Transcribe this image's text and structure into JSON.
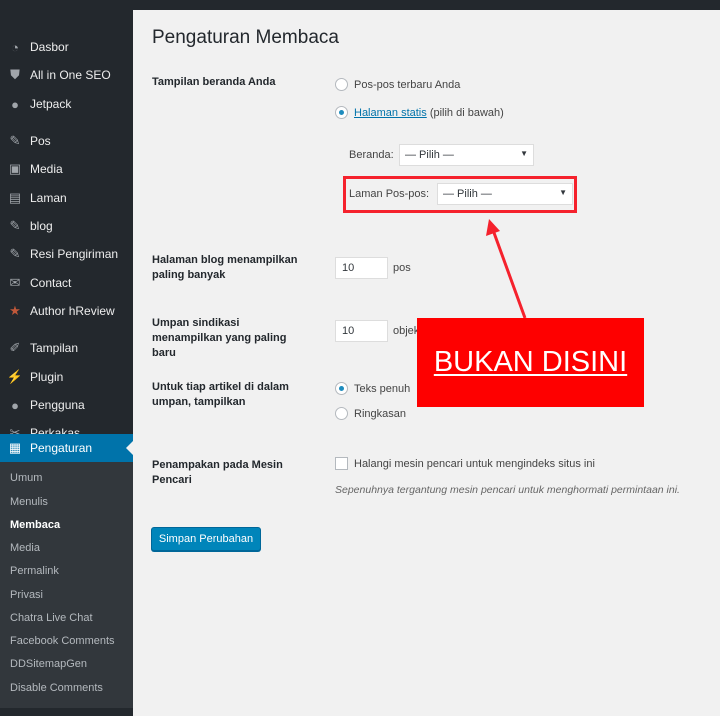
{
  "sidebar": {
    "items": [
      {
        "label": "Dasbor",
        "icon": "dashboard-icon"
      },
      {
        "label": "All in One SEO",
        "icon": "shield-icon"
      },
      {
        "label": "Jetpack",
        "icon": "jetpack-icon"
      },
      {
        "label": "Pos",
        "icon": "pin-icon"
      },
      {
        "label": "Media",
        "icon": "media-icon"
      },
      {
        "label": "Laman",
        "icon": "page-icon"
      },
      {
        "label": "blog",
        "icon": "pin-icon"
      },
      {
        "label": "Resi Pengiriman",
        "icon": "pin-icon"
      },
      {
        "label": "Contact",
        "icon": "mail-icon"
      },
      {
        "label": "Author hReview",
        "icon": "star-icon"
      },
      {
        "label": "Tampilan",
        "icon": "brush-icon"
      },
      {
        "label": "Plugin",
        "icon": "plugin-icon"
      },
      {
        "label": "Pengguna",
        "icon": "user-icon"
      },
      {
        "label": "Perkakas",
        "icon": "wrench-icon"
      },
      {
        "label": "Pengaturan",
        "icon": "settings-icon"
      }
    ],
    "submenu": [
      "Umum",
      "Menulis",
      "Membaca",
      "Media",
      "Permalink",
      "Privasi",
      "Chatra Live Chat",
      "Facebook Comments",
      "DDSitemapGen",
      "Disable Comments"
    ],
    "current_sub": "Membaca"
  },
  "page": {
    "title": "Pengaturan Membaca",
    "front": {
      "label": "Tampilan beranda Anda",
      "opt1": "Pos-pos terbaru Anda",
      "opt2_link": "Halaman statis",
      "opt2_rest": " (pilih di bawah)",
      "beranda_label": "Beranda:",
      "beranda_value": "— Pilih —",
      "posts_label": "Laman Pos-pos:",
      "posts_value": "— Pilih —"
    },
    "blog": {
      "label": "Halaman blog menampilkan paling banyak",
      "value": "10",
      "unit": "pos"
    },
    "feed": {
      "label": "Umpan sindikasi menampilkan yang paling baru",
      "value": "10",
      "unit": "objek"
    },
    "article": {
      "label": "Untuk tiap artikel di dalam umpan, tampilkan",
      "opt1": "Teks penuh",
      "opt2": "Ringkasan"
    },
    "search": {
      "label": "Penampakan pada Mesin Pencari",
      "checkbox": "Halangi mesin pencari untuk mengindeks situs ini",
      "note": "Sepenuhnya tergantung mesin pencari untuk menghormati permintaan ini."
    },
    "save": "Simpan Perubahan"
  },
  "annotation": {
    "text": "BUKAN DISINI",
    "color": "#fe0000"
  }
}
